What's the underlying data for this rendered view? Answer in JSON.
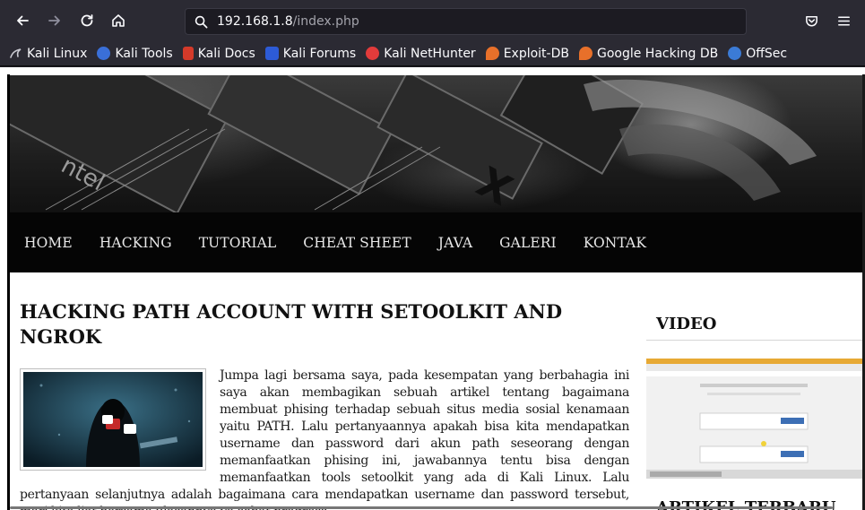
{
  "browser": {
    "url_host": "192.168.1.8",
    "url_path": "/index.php",
    "bookmarks": [
      {
        "label": "Kali Linux",
        "icon": "kali-dragon-icon",
        "color": "#1b1b1b"
      },
      {
        "label": "Kali Tools",
        "icon": "kali-tools-icon",
        "color": "#3a6fd8"
      },
      {
        "label": "Kali Docs",
        "icon": "kali-docs-icon",
        "color": "#d43a2a"
      },
      {
        "label": "Kali Forums",
        "icon": "kali-forums-icon",
        "color": "#2d5bd6"
      },
      {
        "label": "Kali NetHunter",
        "icon": "nethunter-icon",
        "color": "#e23b3b"
      },
      {
        "label": "Exploit-DB",
        "icon": "exploit-db-icon",
        "color": "#e8702a"
      },
      {
        "label": "Google Hacking DB",
        "icon": "ghdb-icon",
        "color": "#e8702a"
      },
      {
        "label": "OffSec",
        "icon": "offsec-icon",
        "color": "#3b7bd6"
      }
    ]
  },
  "site": {
    "menu": [
      "HOME",
      "HACKING",
      "TUTORIAL",
      "CHEAT SHEET",
      "JAVA",
      "GALERI",
      "KONTAK"
    ],
    "article": {
      "title": "HACKING PATH ACCOUNT WITH SETOOLKIT AND NGROK",
      "body": "Jumpa lagi bersama saya, pada kesempatan yang berbahagia ini saya akan membagikan sebuah artikel tentang bagaimana membuat phising terhadap sebuah situs media sosial kenamaan yaitu PATH. Lalu pertanyaannya apakah bisa kita mendapatkan username dan password dari akun path seseorang dengan memanfaatkan phising ini, jawabannya tentu bisa dengan memanfaatkan tools setoolkit yang ada di Kali Linux. Lalu pertanyaan selanjutnya adalah bagaimana cara mendapatkan username dan password tersebut, mari kita liat bersama ulasannya ya sobat progress….."
    },
    "sidebar": {
      "video_title": "VIDEO",
      "latest_title": "ARTIKEL TERBARU"
    }
  }
}
